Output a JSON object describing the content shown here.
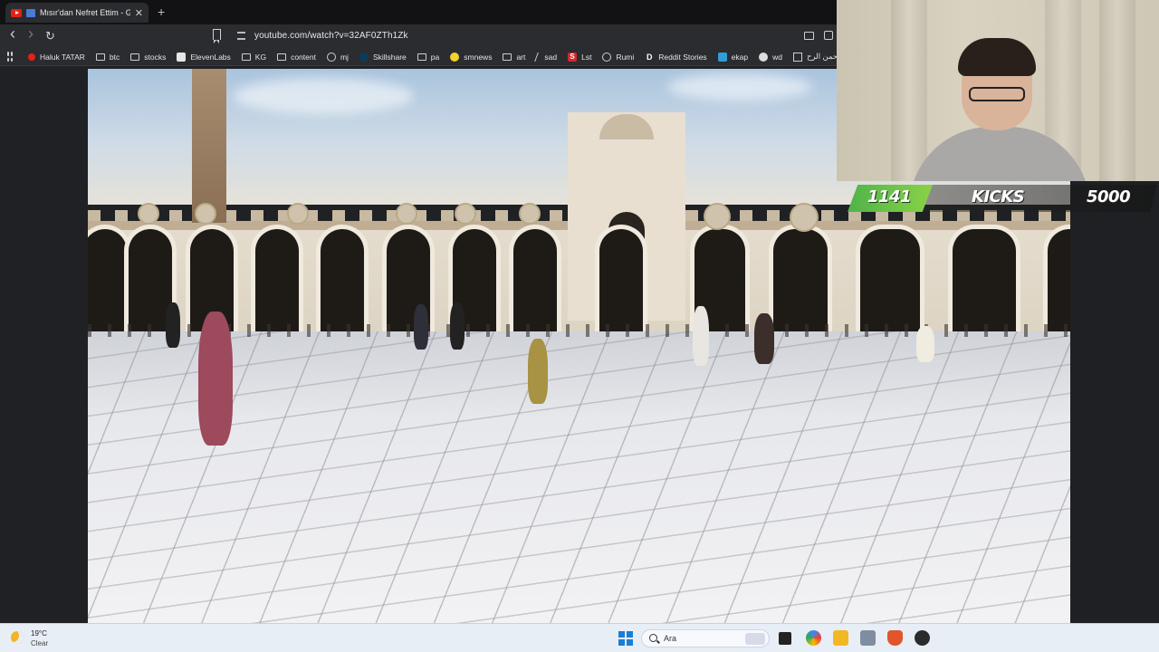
{
  "browser": {
    "tab_title": "Mısır'dan Nefret Ettim - Gelmi",
    "tab_close": "✕",
    "new_tab": "+",
    "url": "youtube.com/watch?v=32AF0ZTh1Zk",
    "nav_back": "‹",
    "nav_forward": "›",
    "nav_reload": "↻",
    "bookmarks": [
      {
        "label": "Haluk TATAR",
        "icon": "youtube-icon"
      },
      {
        "label": "btc",
        "icon": "folder-icon"
      },
      {
        "label": "stocks",
        "icon": "folder-icon"
      },
      {
        "label": "ElevenLabs",
        "icon": "elevenlabs-icon"
      },
      {
        "label": "KG",
        "icon": "folder-icon"
      },
      {
        "label": "content",
        "icon": "folder-icon"
      },
      {
        "label": "mj",
        "icon": "github-icon"
      },
      {
        "label": "Skillshare",
        "icon": "skillshare-icon"
      },
      {
        "label": "pa",
        "icon": "folder-icon"
      },
      {
        "label": "smnews",
        "icon": "smiley-icon"
      },
      {
        "label": "art",
        "icon": "folder-icon"
      },
      {
        "label": "sad",
        "icon": "slash-icon"
      },
      {
        "label": "Lst",
        "icon": "s-icon"
      },
      {
        "label": "Rumi",
        "icon": "globe-icon"
      },
      {
        "label": "Reddit Stories",
        "icon": "d-icon"
      },
      {
        "label": "ekap",
        "icon": "bird-icon"
      },
      {
        "label": "wd",
        "icon": "wd-icon"
      },
      {
        "label": "الرحمن الرح...",
        "icon": "book-icon"
      }
    ]
  },
  "overlay": {
    "kicks_count": "1141",
    "kicks_label": "KICKS",
    "kicks_goal": "5000",
    "progress_fraction": 0.2282,
    "accent": "#6cc247"
  },
  "taskbar": {
    "temperature": "19°C",
    "condition": "Clear",
    "search_placeholder": "Ara"
  }
}
